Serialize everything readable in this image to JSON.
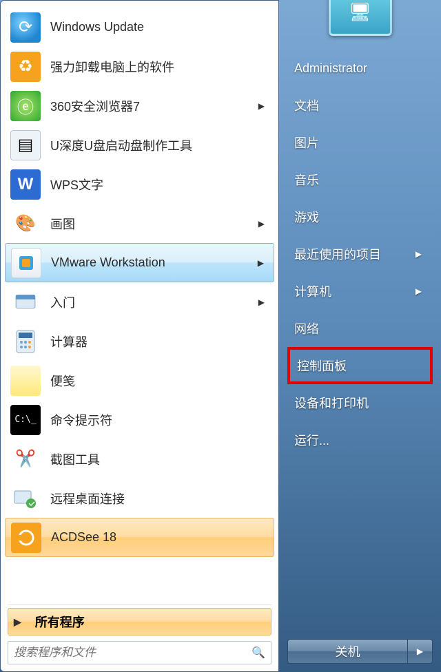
{
  "left": {
    "programs": [
      {
        "label": "Windows Update",
        "icon": "windows-update-icon",
        "has_sub": false
      },
      {
        "label": "强力卸载电脑上的软件",
        "icon": "uninstall-icon",
        "has_sub": false
      },
      {
        "label": "360安全浏览器7",
        "icon": "360-icon",
        "has_sub": true
      },
      {
        "label": "U深度U盘启动盘制作工具",
        "icon": "usb-boot-icon",
        "has_sub": false
      },
      {
        "label": "WPS文字",
        "icon": "wps-icon",
        "has_sub": false
      },
      {
        "label": "画图",
        "icon": "paint-icon",
        "has_sub": true
      },
      {
        "label": "VMware Workstation",
        "icon": "vmware-icon",
        "has_sub": true,
        "hover": true
      },
      {
        "label": "入门",
        "icon": "getting-started-icon",
        "has_sub": true
      },
      {
        "label": "计算器",
        "icon": "calculator-icon",
        "has_sub": false
      },
      {
        "label": "便笺",
        "icon": "sticky-notes-icon",
        "has_sub": false
      },
      {
        "label": "命令提示符",
        "icon": "cmd-icon",
        "has_sub": false
      },
      {
        "label": "截图工具",
        "icon": "snipping-tool-icon",
        "has_sub": false
      },
      {
        "label": "远程桌面连接",
        "icon": "rdp-icon",
        "has_sub": false
      },
      {
        "label": "ACDSee 18",
        "icon": "acdsee-icon",
        "has_sub": false,
        "orange": true
      }
    ],
    "all_programs": "所有程序",
    "search_placeholder": "搜索程序和文件"
  },
  "right": {
    "user": "Administrator",
    "items": [
      {
        "label": "文档"
      },
      {
        "label": "图片"
      },
      {
        "label": "音乐"
      },
      {
        "label": "游戏"
      },
      {
        "label": "最近使用的项目",
        "has_sub": true
      },
      {
        "label": "计算机",
        "has_sub": true
      },
      {
        "label": "网络"
      },
      {
        "label": "控制面板",
        "highlight": true
      },
      {
        "label": "设备和打印机"
      },
      {
        "label": "运行..."
      }
    ],
    "shutdown": "关机"
  },
  "icon_text": {
    "wps": "W",
    "cmd": "C:\\_"
  }
}
